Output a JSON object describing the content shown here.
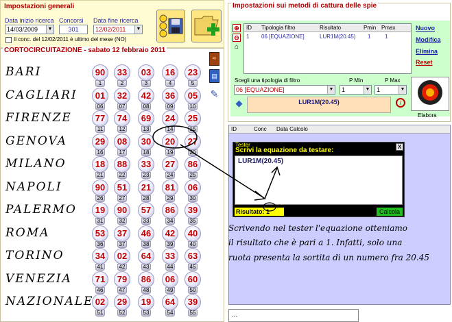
{
  "general": {
    "title": "Impostazioni generali",
    "start_label": "Data inizio ricerca",
    "start_value": "14/03/2009",
    "draws_label": "Concorsi",
    "draws_value": "301",
    "end_label": "Data fine ricerca",
    "end_value": "12/02/2011",
    "checkbox_label": "Il conc. del 12/02/2011 è ultimo del mese (NO)"
  },
  "shortcircuit": {
    "title": "CORTOCIRCUITAZIONE - sabato 12 febbraio 2011"
  },
  "wheels": [
    {
      "name": "BARI",
      "numbers": [
        "90",
        "33",
        "03",
        "16",
        "23"
      ],
      "positions": [
        "1",
        "2",
        "3",
        "4",
        "5"
      ]
    },
    {
      "name": "CAGLIARI",
      "numbers": [
        "01",
        "32",
        "42",
        "36",
        "05"
      ],
      "positions": [
        "06",
        "07",
        "08",
        "09",
        "10"
      ]
    },
    {
      "name": "FIRENZE",
      "numbers": [
        "77",
        "74",
        "69",
        "24",
        "25"
      ],
      "positions": [
        "11",
        "12",
        "13",
        "14",
        "15"
      ]
    },
    {
      "name": "GENOVA",
      "numbers": [
        "29",
        "08",
        "30",
        "20",
        "27"
      ],
      "positions": [
        "16",
        "17",
        "18",
        "19",
        "20"
      ]
    },
    {
      "name": "MILANO",
      "numbers": [
        "18",
        "88",
        "33",
        "27",
        "86"
      ],
      "positions": [
        "21",
        "22",
        "23",
        "24",
        "25"
      ]
    },
    {
      "name": "NAPOLI",
      "numbers": [
        "90",
        "51",
        "21",
        "81",
        "06"
      ],
      "positions": [
        "26",
        "27",
        "28",
        "29",
        "30"
      ]
    },
    {
      "name": "PALERMO",
      "numbers": [
        "19",
        "90",
        "57",
        "86",
        "39"
      ],
      "positions": [
        "31",
        "32",
        "33",
        "34",
        "35"
      ]
    },
    {
      "name": "ROMA",
      "numbers": [
        "53",
        "37",
        "46",
        "42",
        "40"
      ],
      "positions": [
        "36",
        "37",
        "38",
        "39",
        "40"
      ]
    },
    {
      "name": "TORINO",
      "numbers": [
        "34",
        "02",
        "64",
        "33",
        "63"
      ],
      "positions": [
        "41",
        "42",
        "43",
        "44",
        "45"
      ]
    },
    {
      "name": "VENEZIA",
      "numbers": [
        "71",
        "79",
        "86",
        "06",
        "60"
      ],
      "positions": [
        "46",
        "47",
        "48",
        "49",
        "50"
      ]
    },
    {
      "name": "NAZIONALE",
      "numbers": [
        "02",
        "29",
        "19",
        "64",
        "39"
      ],
      "positions": [
        "51",
        "52",
        "53",
        "54",
        "55"
      ]
    }
  ],
  "spy": {
    "title": "Impostazioni sui metodi di cattura delle spie",
    "columns": [
      "ID",
      "Tipologia filtro",
      "Risultato",
      "Pmin",
      "Pmax"
    ],
    "row": [
      "1",
      "06 [EQUAZIONE]",
      "LUR1M(20.45)",
      "1",
      "1"
    ],
    "links": [
      "Nuovo",
      "Modifica",
      "Elimina",
      "Reset"
    ],
    "filter_label": "Scegli una tipologia di filtro",
    "pmin_label": "P Min",
    "pmax_label": "P Max",
    "filter_value": "06 [EQUAZIONE]",
    "pmin_value": "1",
    "pmax_value": "1",
    "result_value": "LUR1M(20.45)",
    "elabora_label": "Elabora"
  },
  "list": {
    "columns": [
      "ID",
      "Conc",
      "Data Calcolo"
    ]
  },
  "tester": {
    "title": "Tester",
    "close": "X",
    "prompt": "Scrivi la equazione da testare:",
    "equation": "LUR1M(20.45)",
    "result_label": "Risultato: 1",
    "compute_label": "Calcola"
  },
  "note": {
    "line1": "Scrivendo nel tester l'equazione otteniamo",
    "line2": "il risultato che è pari a 1. Infatti, solo una",
    "line3": "ruota presenta la sortita di un numero fra 20.45"
  },
  "bottom": {
    "text": "..."
  },
  "colors": {
    "accent_red": "#c00000",
    "panel_yellow": "#fffbd2",
    "panel_green": "#ccffcc",
    "list_blue": "#ccccff"
  }
}
